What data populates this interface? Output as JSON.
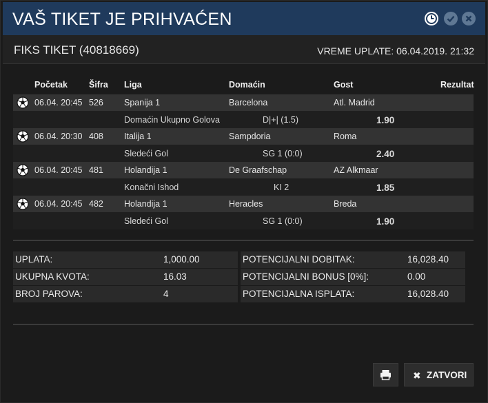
{
  "modal": {
    "title": "VAŠ TIKET JE PRIHVAĆEN",
    "header_icons": [
      "clock-icon",
      "check-circle-icon",
      "close-circle-icon"
    ]
  },
  "ticket": {
    "title": "FIKS TIKET (40818669)",
    "paid_time": "VREME UPLATE: 06.04.2019. 21:32"
  },
  "table": {
    "headers": {
      "start": "Početak",
      "code": "Šifra",
      "league": "Liga",
      "home": "Domaćin",
      "away": "Gost",
      "result": "Rezultat"
    },
    "matches": [
      {
        "start": "06.04. 20:45",
        "code": "526",
        "league": "Spanija 1",
        "home": "Barcelona",
        "away": "Atl. Madrid",
        "market": "Domaćin Ukupno Golova",
        "pick": "D|+| (1.5)",
        "odd": "1.90"
      },
      {
        "start": "06.04. 20:30",
        "code": "408",
        "league": "Italija 1",
        "home": "Sampdoria",
        "away": "Roma",
        "market": "Sledeći Gol",
        "pick": "SG 1 (0:0)",
        "odd": "2.40"
      },
      {
        "start": "06.04. 20:45",
        "code": "481",
        "league": "Holandija 1",
        "home": "De Graafschap",
        "away": "AZ Alkmaar",
        "market": "Konačni Ishod",
        "pick": "KI 2",
        "odd": "1.85"
      },
      {
        "start": "06.04. 20:45",
        "code": "482",
        "league": "Holandija 1",
        "home": "Heracles",
        "away": "Breda",
        "market": "Sledeći Gol",
        "pick": "SG 1 (0:0)",
        "odd": "1.90"
      }
    ]
  },
  "summary": {
    "left": [
      {
        "label": "UPLATA:",
        "value": "1,000.00"
      },
      {
        "label": "UKUPNA KVOTA:",
        "value": "16.03"
      },
      {
        "label": "BROJ PAROVA:",
        "value": "4"
      }
    ],
    "right": [
      {
        "label": "POTENCIJALNI DOBITAK:",
        "value": "16,028.40"
      },
      {
        "label": "POTENCIJALNI BONUS [0%]:",
        "value": "0.00"
      },
      {
        "label": "POTENCIJALNA ISPLATA:",
        "value": "16,028.40"
      }
    ]
  },
  "buttons": {
    "print_icon": "printer-icon",
    "close_label": "ZATVORI"
  },
  "colors": {
    "header_bg": "#1f3a5c",
    "row_dark": "#333333",
    "row_light": "#1f1f1f"
  }
}
